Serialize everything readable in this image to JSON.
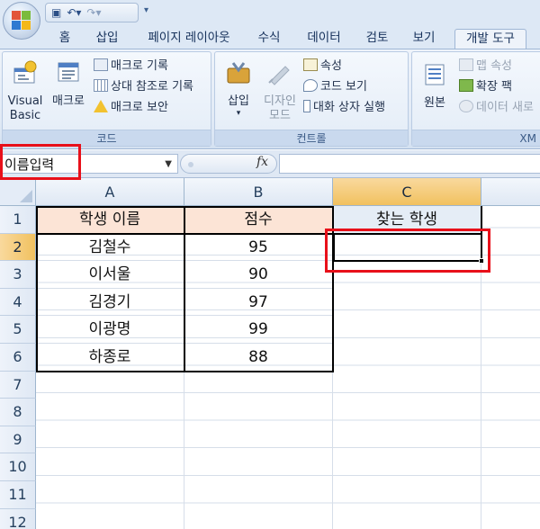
{
  "tabs": [
    "홈",
    "삽입",
    "페이지 레이아웃",
    "수식",
    "데이터",
    "검토",
    "보기",
    "개발 도구"
  ],
  "active_tab": "개발 도구",
  "ribbon": {
    "code": {
      "label": "코드",
      "visual_basic": [
        "Visual",
        "Basic"
      ],
      "macro": "매크로",
      "record_macro": "매크로 기록",
      "relative_ref": "상대 참조로 기록",
      "macro_security": "매크로 보안"
    },
    "controls": {
      "label": "컨트롤",
      "insert": "삽입",
      "design_mode": [
        "디자인",
        "모드"
      ],
      "properties": "속성",
      "view_code": "코드 보기",
      "run_dialog": "대화 상자 실행"
    },
    "xml": {
      "label": "XM",
      "source": "원본",
      "map_properties": "맵 속성",
      "expansion_packs": "확장 팩",
      "refresh_data": "데이터 새로"
    }
  },
  "formula_bar": {
    "name_box": "이름입력",
    "fx": "fx",
    "formula": ""
  },
  "sheet": {
    "columns": [
      "A",
      "B",
      "C"
    ],
    "rows": [
      "1",
      "2",
      "3",
      "4",
      "5",
      "6",
      "7",
      "8",
      "9",
      "10",
      "11",
      "12"
    ],
    "header": [
      "학생 이름",
      "점수",
      "찾는 학생"
    ],
    "data": [
      [
        "김철수",
        "95"
      ],
      [
        "이서울",
        "90"
      ],
      [
        "김경기",
        "97"
      ],
      [
        "이광명",
        "99"
      ],
      [
        "하종로",
        "88"
      ]
    ],
    "active_cell": "C2"
  },
  "colors": {
    "header_fill": "#fce4d6",
    "highlight_red": "#e8101a",
    "selected_header": "#f1c15f"
  }
}
